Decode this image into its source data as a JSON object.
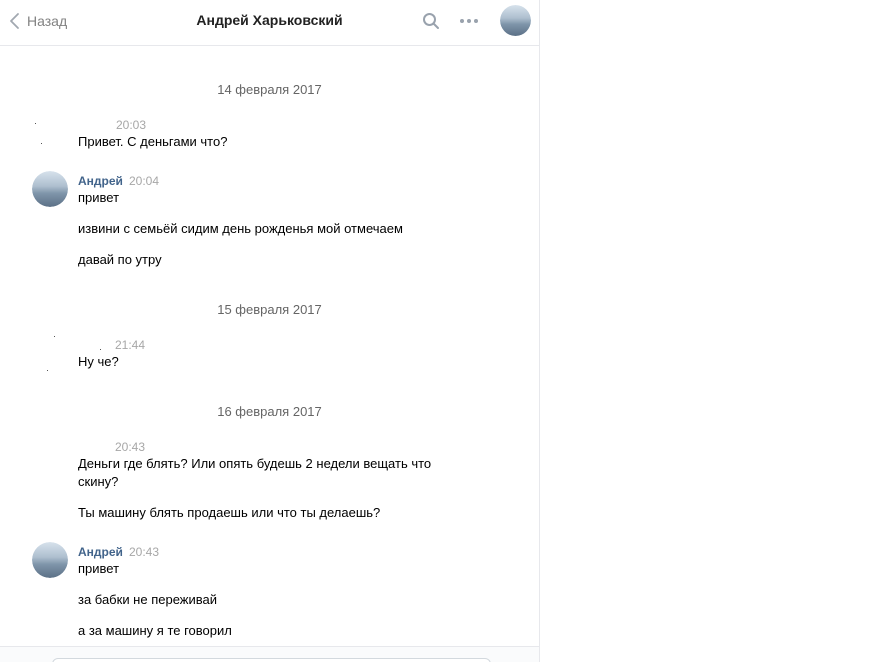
{
  "header": {
    "back_label": "Назад",
    "title": "Андрей Харьковский"
  },
  "colors": {
    "link_blue": "#42648b",
    "time_grey": "#a7a7a7",
    "divider": "#e7e8ec"
  },
  "icons": [
    "chevron-left-icon",
    "search-icon",
    "more-icon"
  ],
  "messages": {
    "d1": "14 февраля 2017",
    "m1": {
      "time": "20:03",
      "lines": [
        "Привет. С деньгами что?"
      ]
    },
    "m2": {
      "author": "Андрей",
      "time": "20:04",
      "lines": [
        "привет",
        "извини с семьёй сидим день рожденья мой отмечаем",
        "давай по утру"
      ]
    },
    "d2": "15 февраля 2017",
    "m3": {
      "time": "21:44",
      "lines": [
        "Ну че?"
      ]
    },
    "d3": "16 февраля 2017",
    "m4": {
      "time": "20:43",
      "lines": [
        "Деньги где блять? Или опять будешь 2 недели вещать что скину?",
        "Ты машину блять продаешь или что ты делаешь?"
      ]
    },
    "m5": {
      "author": "Андрей",
      "time": "20:43",
      "lines": [
        "привет",
        "за бабки не переживай",
        "а за машину я те говорил"
      ]
    }
  }
}
